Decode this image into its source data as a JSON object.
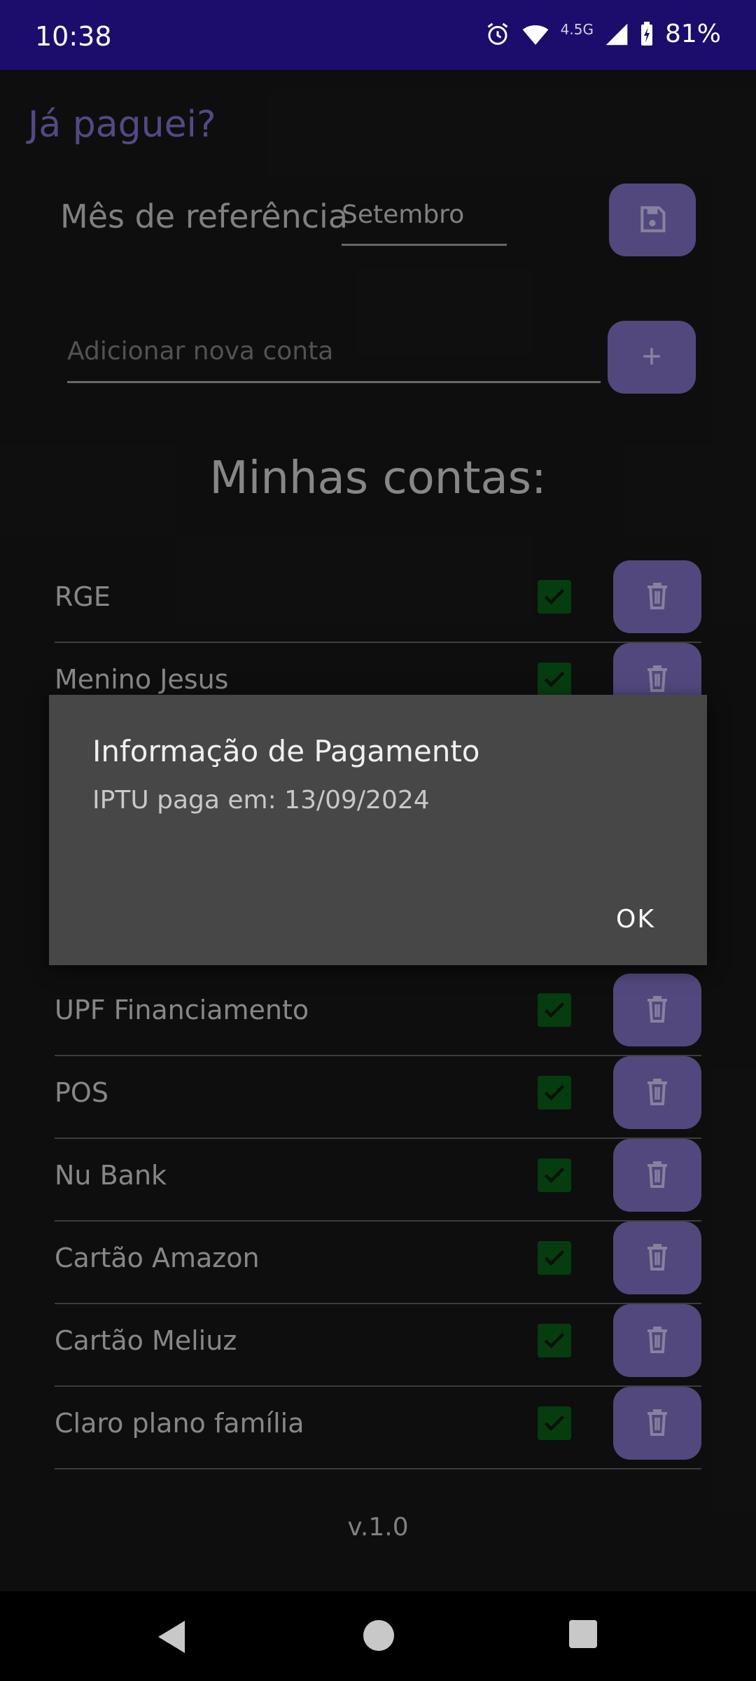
{
  "status_bar": {
    "time": "10:38",
    "network_label": "4.5G",
    "battery": "81%"
  },
  "app": {
    "title": "Já paguei?",
    "reference_month_label": "Mês de referência",
    "reference_month_value": "Setembro",
    "new_account_placeholder": "Adicionar nova conta",
    "add_button_label": "+",
    "section_title": "Minhas contas:",
    "accounts": [
      {
        "name": "RGE",
        "paid": true
      },
      {
        "name": "Menino Jesus",
        "paid": true
      },
      {
        "name": "UPF Financiamento",
        "paid": true
      },
      {
        "name": "POS",
        "paid": true
      },
      {
        "name": "Nu Bank",
        "paid": true
      },
      {
        "name": "Cartão Amazon",
        "paid": true
      },
      {
        "name": "Cartão Meliuz",
        "paid": true
      },
      {
        "name": "Claro plano família",
        "paid": true
      }
    ],
    "version": "v.1.0"
  },
  "dialog": {
    "title": "Informação de Pagamento",
    "message": "IPTU paga em: 13/09/2024",
    "ok_label": "OK"
  },
  "colors": {
    "status_bar": "#1c0c6b",
    "accent": "#7a6ab8",
    "title": "#7b6cc4",
    "checkbox": "#0a5b17",
    "dialog_bg": "#474747"
  }
}
